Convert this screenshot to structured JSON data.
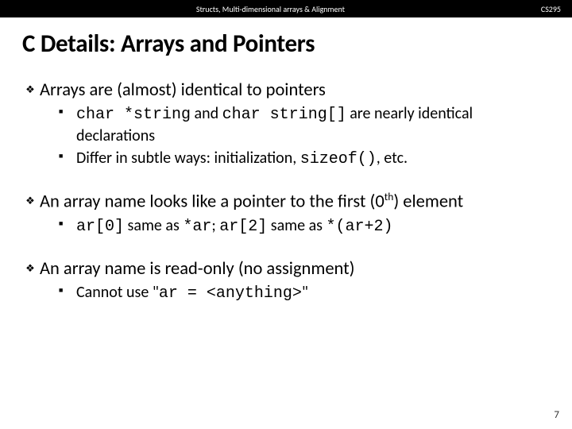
{
  "topbar": {
    "title": "Structs, Multi-dimensional arrays & Alignment",
    "course": "CS295"
  },
  "title": "C Details:  Arrays and Pointers",
  "b1": {
    "main": "Arrays are (almost) identical to pointers",
    "s1a": "char *string",
    "s1b": " and ",
    "s1c": "char string[]",
    "s1d": " are nearly identical declarations",
    "s2a": "Differ in subtle ways:  initialization, ",
    "s2b": "sizeof()",
    "s2c": ", etc."
  },
  "b2": {
    "main_a": "An array name looks like a pointer to the first (0",
    "main_sup": "th",
    "main_b": ") element",
    "s1a": "ar[0]",
    "s1b": " same as ",
    "s1c": "*ar",
    "s1d": ";  ",
    "s1e": "ar[2]",
    "s1f": " same as ",
    "s1g": "*(ar+2)"
  },
  "b3": {
    "main": "An array name is read-only (no assignment)",
    "s1a": "Cannot use \"",
    "s1b": "ar = <anything>",
    "s1c": "\""
  },
  "pagenum": "7"
}
